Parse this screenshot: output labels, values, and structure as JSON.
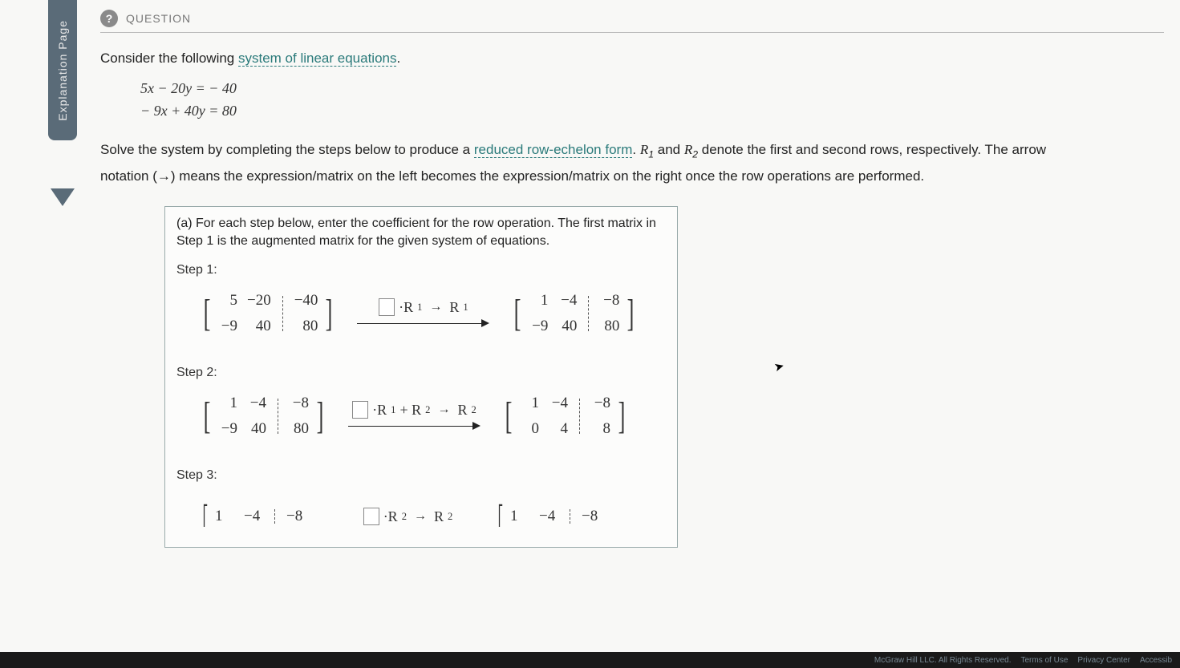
{
  "sidebar": {
    "tab_label": "Explanation Page"
  },
  "header": {
    "icon": "?",
    "label": "QUESTION"
  },
  "prompt": {
    "lead": "Consider the following ",
    "link": "system of linear equations",
    "tail": "."
  },
  "equations": {
    "line1": "5x − 20y = − 40",
    "line2": "− 9x + 40y = 80"
  },
  "instructions": {
    "p1a": "Solve the system by completing the steps below to produce a ",
    "p1link": "reduced row-echelon form",
    "p1b": ". ",
    "r1": "R",
    "r1sub": "1",
    "and": " and ",
    "r2": "R",
    "r2sub": "2",
    "p1c": " denote the first and second rows, respectively. The arrow",
    "p2a": "notation (→) means the expression/matrix on the left becomes the expression/matrix on the right once the row operations are performed."
  },
  "task": {
    "intro": "(a) For each step below, enter the coefficient for the row operation. The first matrix in Step 1 is the augmented matrix for the given system of equations.",
    "steps": [
      {
        "label": "Step 1:",
        "left": {
          "c1": [
            "5",
            "−9"
          ],
          "c2": [
            "−20",
            "40"
          ],
          "aug": [
            "−40",
            "80"
          ]
        },
        "op": {
          "parts": [
            "·R",
            "1",
            " → R",
            "1"
          ]
        },
        "right": {
          "c1": [
            "1",
            "−9"
          ],
          "c2": [
            "−4",
            "40"
          ],
          "aug": [
            "−8",
            "80"
          ]
        }
      },
      {
        "label": "Step 2:",
        "left": {
          "c1": [
            "1",
            "−9"
          ],
          "c2": [
            "−4",
            "40"
          ],
          "aug": [
            "−8",
            "80"
          ]
        },
        "op": {
          "parts": [
            "·R",
            "1",
            " + R",
            "2",
            " → R",
            "2"
          ]
        },
        "right": {
          "c1": [
            "1",
            "0"
          ],
          "c2": [
            "−4",
            "4"
          ],
          "aug": [
            "−8",
            "8"
          ]
        }
      },
      {
        "label": "Step 3:",
        "left_partial": {
          "row": [
            "1",
            "−4",
            "−8"
          ]
        },
        "op": {
          "parts": [
            "·R",
            "2",
            " → R",
            "2"
          ]
        },
        "right_partial": {
          "row": [
            "1",
            "−4",
            "−8"
          ]
        }
      }
    ]
  },
  "footer": {
    "copyright": "McGraw Hill LLC. All Rights Reserved.",
    "terms": "Terms of Use",
    "privacy": "Privacy Center",
    "access": "Accessib"
  }
}
